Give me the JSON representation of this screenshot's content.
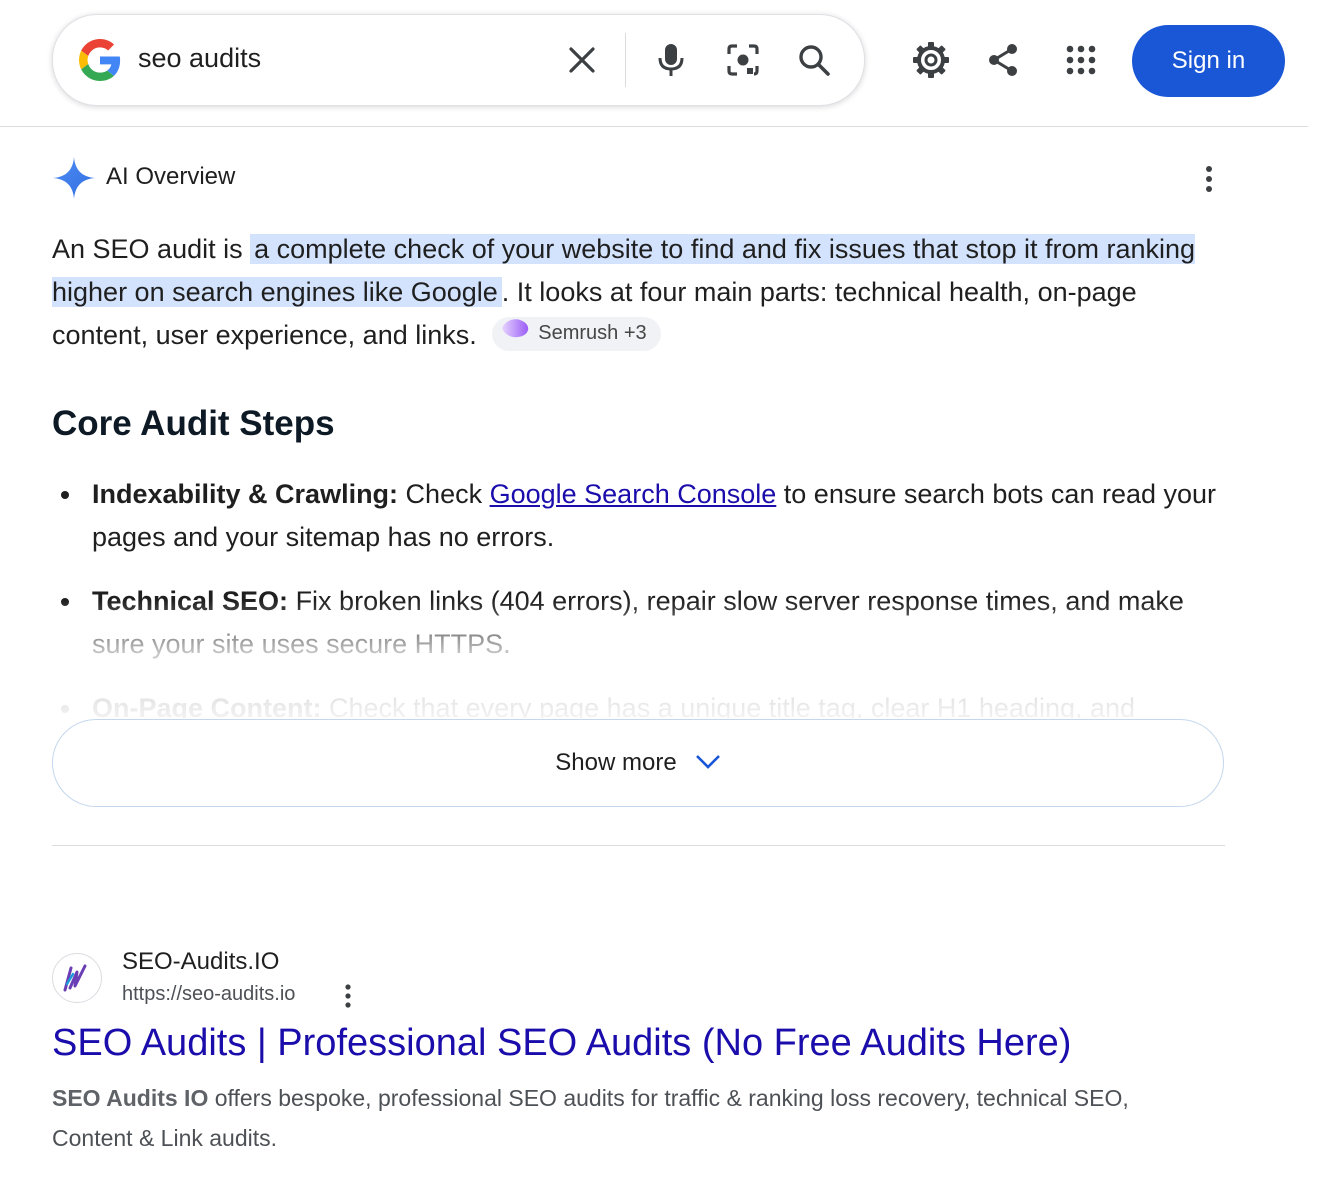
{
  "search": {
    "query": "seo audits",
    "sign_in_label": "Sign in"
  },
  "icons": {
    "clear": "close-icon",
    "voice": "microphone-icon",
    "lens": "camera-lens-icon",
    "search": "search-icon",
    "settings": "gear-icon",
    "share": "share-icon",
    "apps": "apps-grid-icon",
    "ai_spark": "sparkle-icon",
    "more": "more-vert-icon"
  },
  "colors": {
    "brand_blue": "#1a57d6",
    "highlight": "#d3e3fd",
    "link": "#1a0dab"
  },
  "ai_overview": {
    "label": "AI Overview",
    "intro_before": "An SEO audit is ",
    "intro_highlight": "a complete check of your website to find and fix issues that stop it from ranking higher on search engines like Google",
    "intro_after": ". It looks at four main parts: technical health, on-page content, user experience, and links.",
    "source_chip": "Semrush +3",
    "section_heading": "Core Audit Steps",
    "steps": [
      {
        "title": "Indexability & Crawling:",
        "text_before": " Check ",
        "link": "Google Search Console",
        "text_after": " to ensure search bots can read your pages and your sitemap has no errors."
      },
      {
        "title": "Technical SEO:",
        "text": " Fix broken links (404 errors), repair slow server response times, and make sure your site uses secure HTTPS."
      },
      {
        "title": "On-Page Content:",
        "text": " Check that every page has a unique title tag, clear H1 heading, and"
      }
    ],
    "show_more_label": "Show more"
  },
  "result": {
    "site_name": "SEO-Audits.IO",
    "url": "https://seo-audits.io",
    "title": "SEO Audits | Professional SEO Audits (No Free Audits Here)",
    "snippet_bold": "SEO Audits IO",
    "snippet_rest": " offers bespoke, professional SEO audits for traffic & ranking loss recovery, technical SEO, Content & Link audits."
  }
}
